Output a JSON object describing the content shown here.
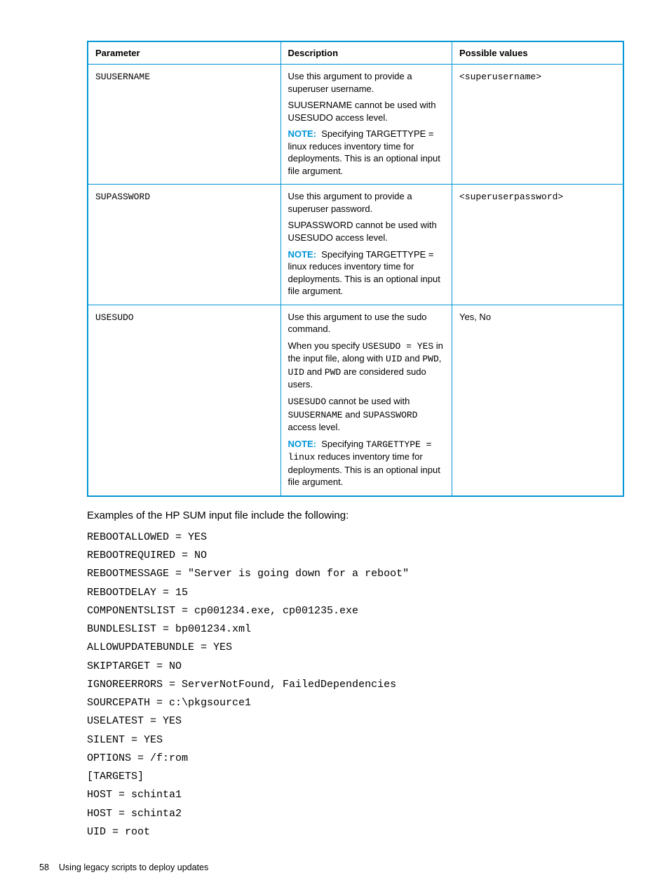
{
  "table": {
    "headers": [
      "Parameter",
      "Description",
      "Possible values"
    ],
    "rows": [
      {
        "param": "SUUSERNAME",
        "desc": {
          "p1": "Use this argument to provide a superuser username.",
          "p2": "SUUSERNAME cannot be used with USESUDO access level.",
          "note_label": "NOTE:",
          "note_text": "Specifying TARGETTYPE = linux reduces inventory time for deployments. This is an optional input file argument."
        },
        "values": "<superusername>"
      },
      {
        "param": "SUPASSWORD",
        "desc": {
          "p1": "Use this argument to provide a superuser password.",
          "p2": "SUPASSWORD cannot be used with USESUDO access level.",
          "note_label": "NOTE:",
          "note_text": "Specifying TARGETTYPE = linux reduces inventory time for deployments. This is an optional input file argument."
        },
        "values": "<superuserpassword>"
      },
      {
        "param": "USESUDO",
        "desc_u": {
          "p1": "Use this argument to use the sudo command.",
          "p2a": "When you specify ",
          "p2code1": "USESUDO = YES",
          "p2b": " in the input file, along with ",
          "p2code2": "UID",
          "p2c": " and ",
          "p2code3": "PWD",
          "p2d": ", ",
          "p2code4": "UID",
          "p2e": " and ",
          "p2code5": "PWD",
          "p2f": " are considered sudo users.",
          "p3code1": "USESUDO",
          "p3a": " cannot be used with ",
          "p3code2": "SUUSERNAME",
          "p3b": " and ",
          "p3code3": "SUPASSWORD",
          "p3c": " access level.",
          "note_label": "NOTE:",
          "note_a": "Specifying ",
          "note_code": "TARGETTYPE = linux",
          "note_b": " reduces inventory time for deployments. This is an optional input file argument."
        },
        "values": "Yes, No"
      }
    ]
  },
  "intro": "Examples of the HP SUM input file include the following:",
  "code": "REBOOTALLOWED = YES\nREBOOTREQUIRED = NO\nREBOOTMESSAGE = \"Server is going down for a reboot\"\nREBOOTDELAY = 15\nCOMPONENTSLIST = cp001234.exe, cp001235.exe\nBUNDLESLIST = bp001234.xml\nALLOWUPDATEBUNDLE = YES\nSKIPTARGET = NO\nIGNOREERRORS = ServerNotFound, FailedDependencies\nSOURCEPATH = c:\\pkgsource1\nUSELATEST = YES\nSILENT = YES\nOPTIONS = /f:rom\n[TARGETS]\nHOST = schinta1\nHOST = schinta2\nUID = root",
  "footer": {
    "page": "58",
    "title": "Using legacy scripts to deploy updates"
  }
}
